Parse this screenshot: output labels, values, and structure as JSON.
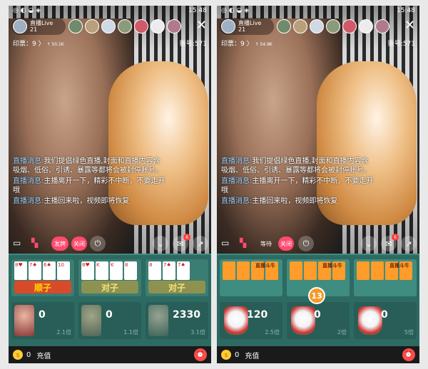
{
  "status": {
    "time": "15:48"
  },
  "phones": [
    {
      "host": {
        "name": "直播Live",
        "count": "21"
      },
      "info": "印票：9 〉",
      "info_small": "↑ 50.1K",
      "account": "账号:571",
      "messages": [
        {
          "head": "直播消息:",
          "text": "我们提倡绿色直播,封面和直播内容含吸烟、低俗、引诱、暴露等都将会被封停账号。"
        },
        {
          "head": "直播消息:",
          "text": "主播离开一下，精彩不中断，不要走开哦"
        },
        {
          "head": "直播消息:",
          "text": "主播回来啦，视频即将恢复"
        }
      ],
      "controls": {
        "deal": "发牌",
        "close": "关闭",
        "badge": "6"
      },
      "boards": [
        {
          "cards": [
            "8♥",
            "7♠",
            "6♠",
            "10"
          ],
          "banner": "顺子",
          "color": "#ff6e3a"
        },
        {
          "cards": [
            "8♥",
            "K",
            "K",
            "8"
          ],
          "banner": "对子",
          "color": "#a9ad6a"
        },
        {
          "cards": [
            "8",
            "7♠",
            "7♠"
          ],
          "banner": "对子",
          "color": "#a9ad6a"
        }
      ],
      "bets": [
        {
          "value": "0",
          "mult": "2.1倍"
        },
        {
          "value": "0",
          "mult": "1.1倍"
        },
        {
          "value": "2330",
          "mult": "3.1倍"
        }
      ],
      "coins": "0",
      "recharge": "充值"
    },
    {
      "host": {
        "name": "直播Live",
        "count": "21"
      },
      "info": "印票：9 〉",
      "info_small": "↑ 54.9K",
      "account": "账号:571",
      "messages": [
        {
          "head": "直播消息:",
          "text": "我们提倡绿色直播,封面和直播内容含吸烟、低俗、引诱、暴露等都将会被封停账号。"
        },
        {
          "head": "直播消息:",
          "text": "主播离开一下，精彩不中断，不要走开哦"
        },
        {
          "head": "直播消息:",
          "text": "主播回来啦，视频即将恢复"
        }
      ],
      "controls": {
        "wait": "等待",
        "close": "关闭",
        "badge": "6"
      },
      "boards": [
        {
          "label": "直播斗牛"
        },
        {
          "label": "直播斗牛"
        },
        {
          "label": "直播斗牛"
        }
      ],
      "timer": "13",
      "bets": [
        {
          "value": "120",
          "mult": "2.5倍"
        },
        {
          "value": "0",
          "mult": "2倍"
        },
        {
          "value": "0",
          "mult": "5倍"
        }
      ],
      "coins": "0",
      "recharge": "充值"
    }
  ]
}
